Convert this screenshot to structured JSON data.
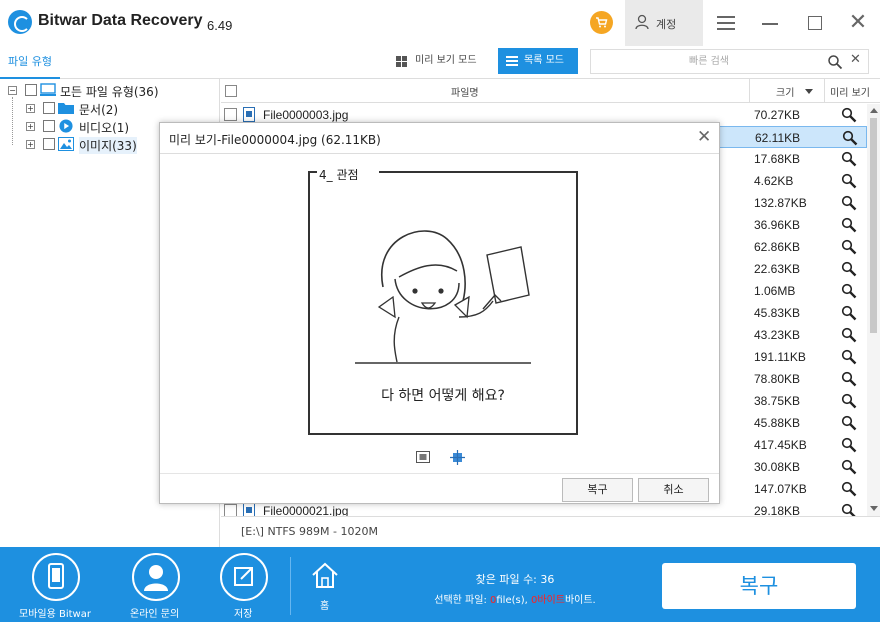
{
  "app": {
    "title": "Bitwar Data Recovery",
    "version": "6.49"
  },
  "header": {
    "cart_icon": "cart-icon",
    "account_label": "계정"
  },
  "toolbar": {
    "tab_filetype": "파일 유형",
    "preview_mode_label": "미리 보기 모드",
    "list_mode_label": "목록 모드",
    "search_placeholder": "빠른 검색"
  },
  "tree": {
    "root": {
      "label": "모든 파일 유형(36)"
    },
    "children": [
      {
        "label": "문서(2)",
        "icon": "folder-icon"
      },
      {
        "label": "비디오(1)",
        "icon": "video-icon"
      },
      {
        "label": "이미지(33)",
        "icon": "image-icon"
      }
    ]
  },
  "list": {
    "columns": {
      "name": "파일명",
      "size": "크기",
      "preview": "미리 보기"
    },
    "rows": [
      {
        "name": "File0000003.jpg",
        "size": "70.27KB"
      },
      {
        "name": "File0000004.jpg",
        "size": "62.11KB",
        "selected": true
      },
      {
        "name": "",
        "size": "17.68KB"
      },
      {
        "name": "",
        "size": "4.62KB"
      },
      {
        "name": "",
        "size": "132.87KB"
      },
      {
        "name": "",
        "size": "36.96KB"
      },
      {
        "name": "",
        "size": "62.86KB"
      },
      {
        "name": "",
        "size": "22.63KB"
      },
      {
        "name": "",
        "size": "1.06MB"
      },
      {
        "name": "",
        "size": "45.83KB"
      },
      {
        "name": "",
        "size": "43.23KB"
      },
      {
        "name": "",
        "size": "191.11KB"
      },
      {
        "name": "",
        "size": "78.80KB"
      },
      {
        "name": "",
        "size": "38.75KB"
      },
      {
        "name": "",
        "size": "45.88KB"
      },
      {
        "name": "",
        "size": "417.45KB"
      },
      {
        "name": "",
        "size": "30.08KB"
      },
      {
        "name": "",
        "size": "147.07KB"
      },
      {
        "name": "File0000021.jpg",
        "size": "29.18KB"
      }
    ],
    "status": "[E:\\] NTFS 989M - 1020M"
  },
  "dialog": {
    "title": "미리 보기-File0000004.jpg (62.11KB)",
    "image_heading": "4_ 관점",
    "image_caption": "다 하면 어떻게 해요?",
    "recover_label": "복구",
    "cancel_label": "취소"
  },
  "bottom": {
    "mobile_label": "모바일용 Bitwar",
    "online_label": "온라인 문의",
    "save_label": "저장",
    "home_label": "홈",
    "found_label": "찾은 파일 수: 36",
    "selected_prefix": "선택한 파일: ",
    "selected_files": "0",
    "selected_files_unit": "file(s), ",
    "selected_bytes": "0바이트",
    "selected_bytes_unit": "바이트.",
    "recover_label": "복구"
  },
  "colors": {
    "accent": "#1e90e0",
    "cart": "#f5a623",
    "highlight": "#cce6fb",
    "alert": "#ff2020"
  }
}
